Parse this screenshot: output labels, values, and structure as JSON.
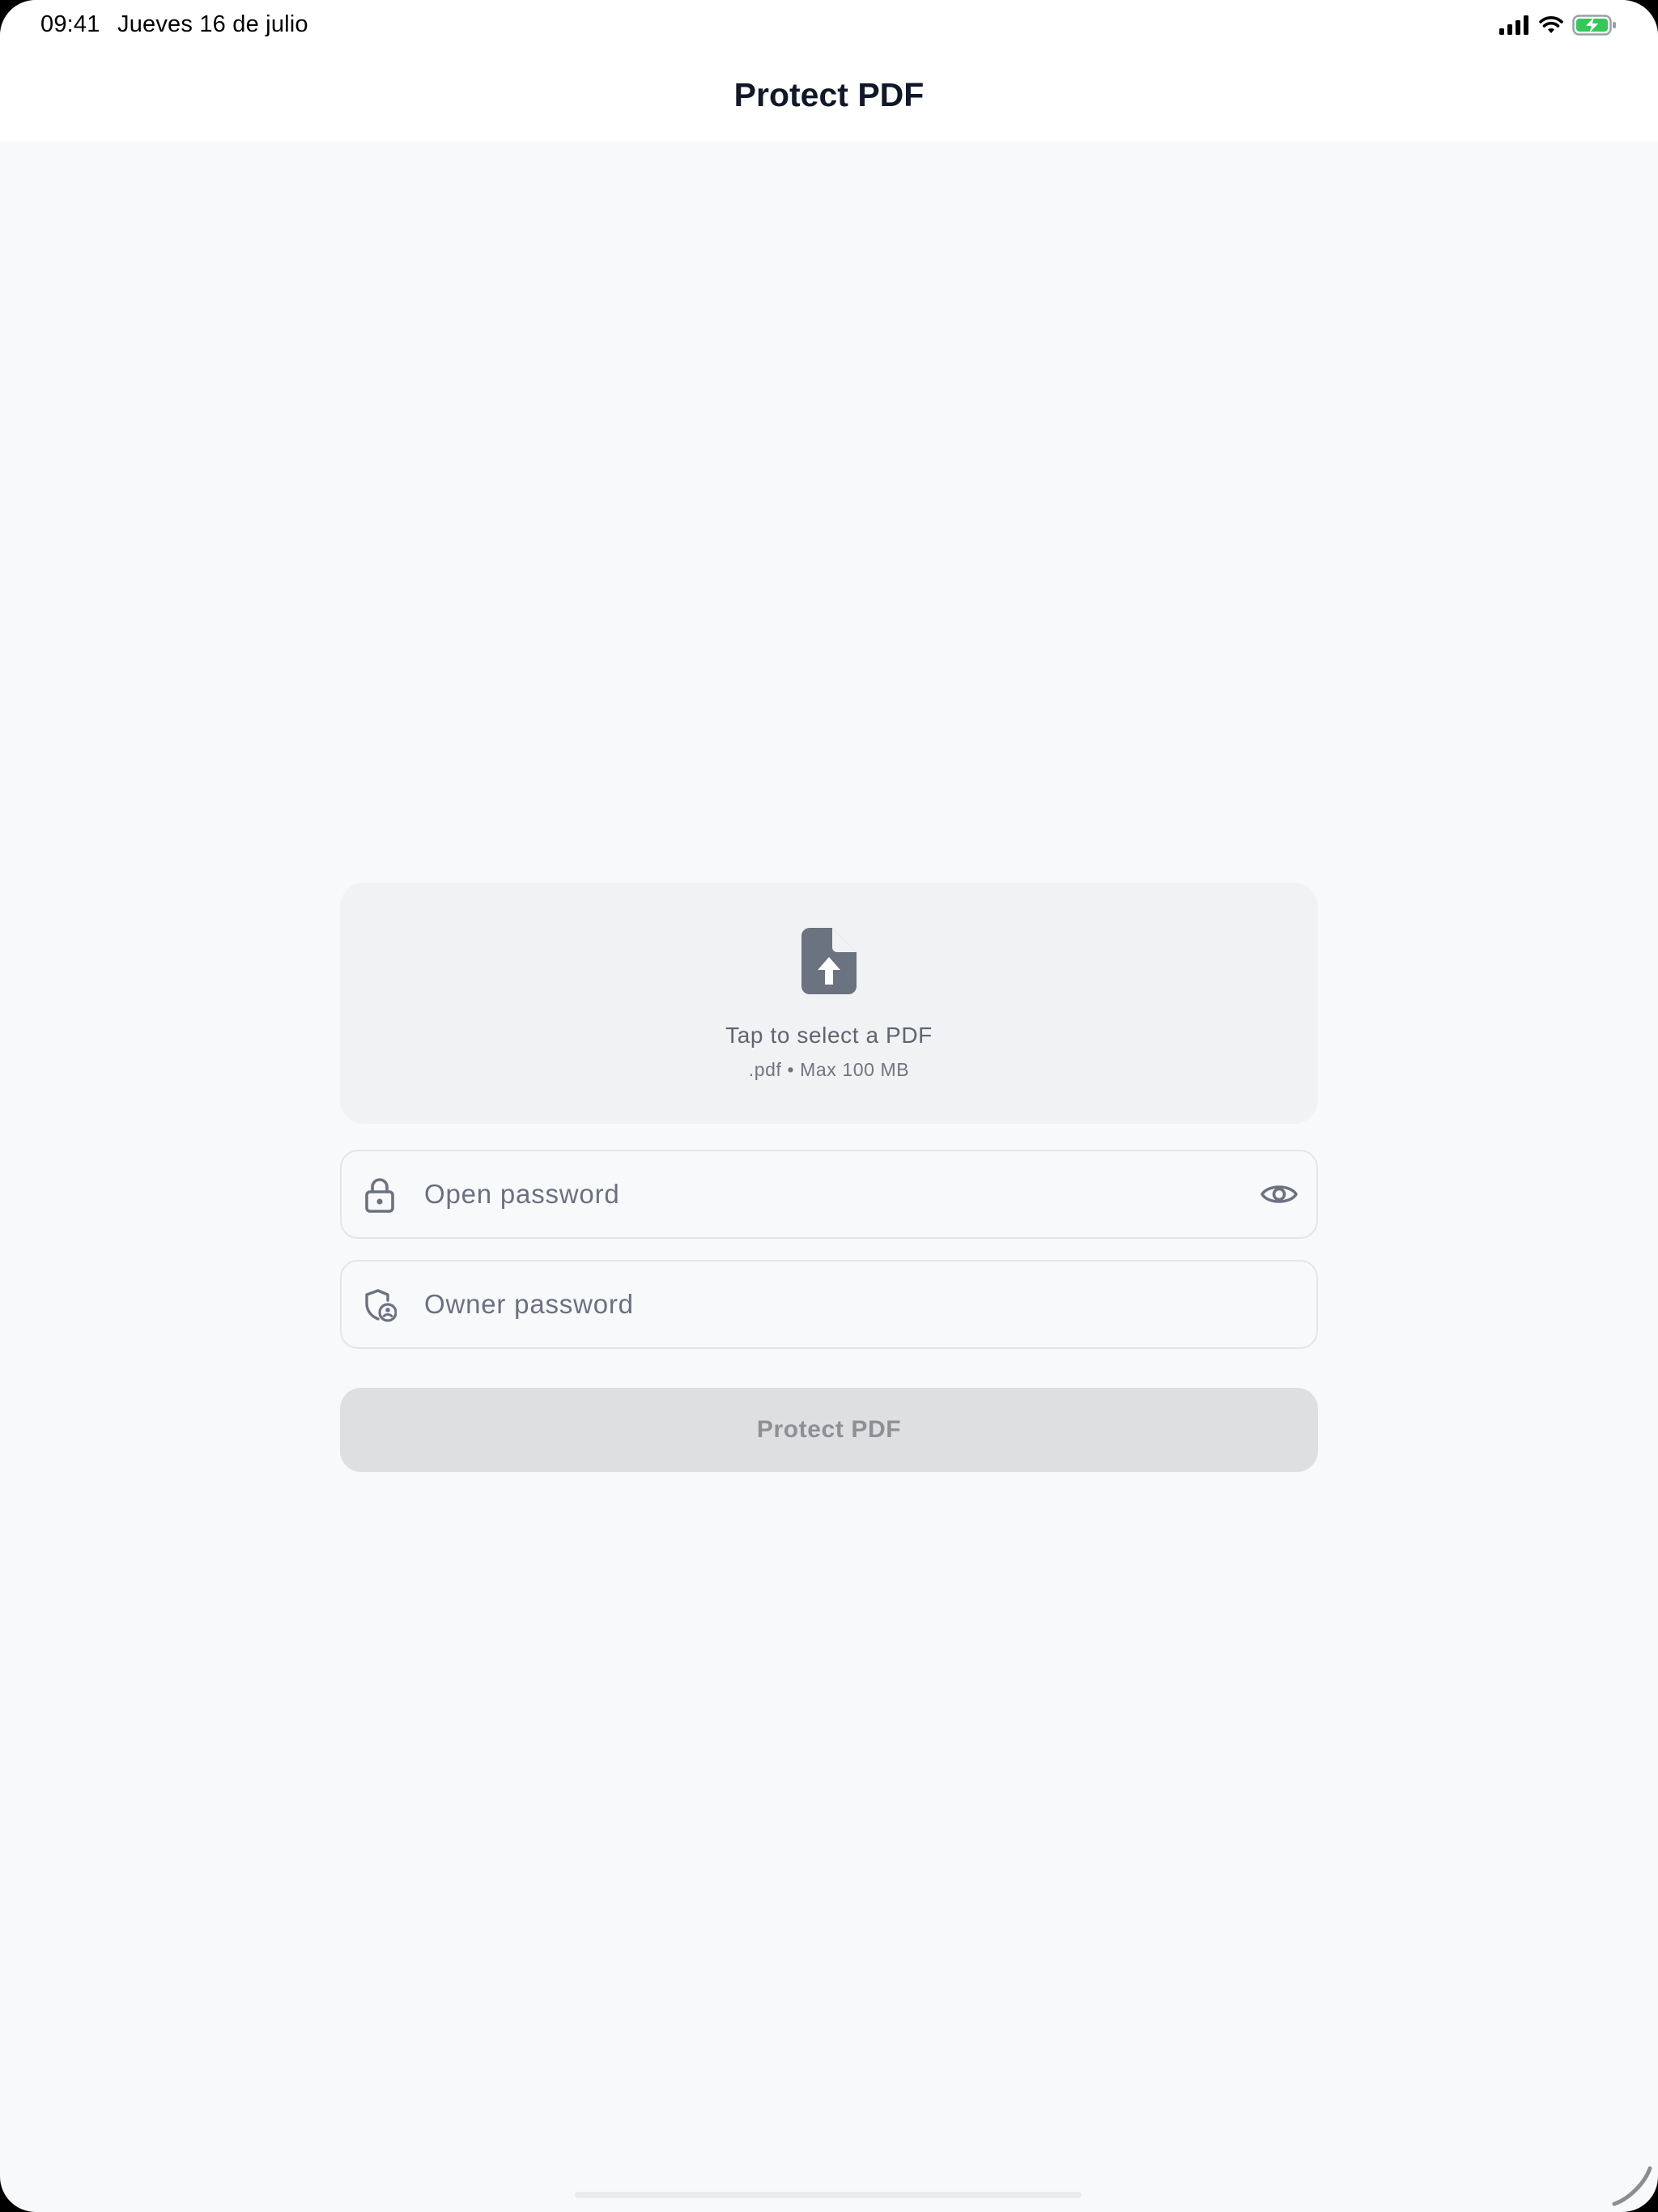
{
  "status_bar": {
    "time": "09:41",
    "date": "Jueves 16 de julio",
    "icons": [
      "cellular-signal-icon",
      "wifi-icon",
      "battery-charging-icon"
    ],
    "battery_color": "#34c759"
  },
  "nav": {
    "title": "Protect PDF"
  },
  "drop_zone": {
    "icon": "file-upload-icon",
    "title": "Tap to select a PDF",
    "subtitle": ".pdf • Max 100 MB"
  },
  "open_password": {
    "icon": "lock-icon",
    "placeholder": "Open password",
    "value": "",
    "toggle_icon": "eye-icon"
  },
  "owner_password": {
    "icon": "shield-user-icon",
    "placeholder": "Owner password",
    "value": ""
  },
  "protect_button": {
    "label": "Protect PDF",
    "enabled": false
  }
}
